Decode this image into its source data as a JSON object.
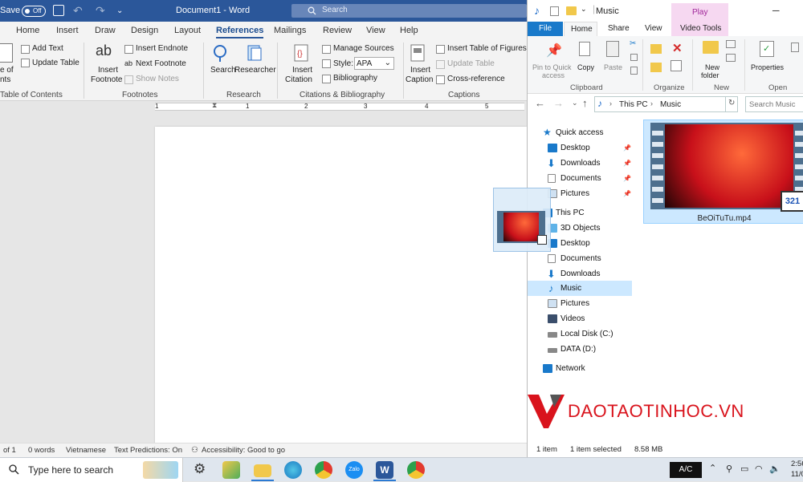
{
  "word": {
    "title": "Document1 - Word",
    "autosave_label": "Save",
    "autosave_state": "Off",
    "search_placeholder": "Search",
    "tabs": [
      "Home",
      "Insert",
      "Draw",
      "Design",
      "Layout",
      "References",
      "Mailings",
      "Review",
      "View",
      "Help"
    ],
    "active_tab": "References",
    "ribbon": {
      "toc_line1": "e of",
      "toc_line2": "nts",
      "add_text": "Add Text",
      "update_table": "Update Table",
      "toc_group": "Table of Contents",
      "insert_footnote_1": "Insert",
      "insert_footnote_2": "Footnote",
      "insert_endnote": "Insert Endnote",
      "next_footnote": "Next Footnote",
      "show_notes": "Show Notes",
      "footnotes_group": "Footnotes",
      "search": "Search",
      "researcher": "Researcher",
      "research_group": "Research",
      "insert_citation_1": "Insert",
      "insert_citation_2": "Citation",
      "manage_sources": "Manage Sources",
      "style_label": "Style:",
      "style_value": "APA",
      "bibliography": "Bibliography",
      "citations_group": "Citations & Bibliography",
      "insert_caption_1": "Insert",
      "insert_caption_2": "Caption",
      "insert_table_figures": "Insert Table of Figures",
      "update_table_2": "Update Table",
      "cross_reference": "Cross-reference",
      "captions_group": "Captions"
    },
    "ruler_numbers": [
      "1",
      "1",
      "2",
      "3",
      "4",
      "5"
    ],
    "status": {
      "page": "of 1",
      "words": "0 words",
      "language": "Vietnamese",
      "predictions": "Text Predictions: On",
      "accessibility": "Accessibility: Good to go"
    }
  },
  "explorer": {
    "title": "Music",
    "contextual_group": "Play",
    "tabs": [
      "File",
      "Home",
      "Share",
      "View",
      "Video Tools"
    ],
    "ribbon": {
      "pin_1": "Pin to Quick",
      "pin_2": "access",
      "copy": "Copy",
      "paste": "Paste",
      "clipboard_group": "Clipboard",
      "organize_group": "Organize",
      "new_folder_1": "New",
      "new_folder_2": "folder",
      "new_group": "New",
      "properties": "Properties",
      "open_group": "Open"
    },
    "breadcrumb": [
      "This PC",
      "Music"
    ],
    "search_placeholder": "Search Music",
    "nav": [
      {
        "label": "Quick access",
        "pinned": false,
        "icon": "star-icon"
      },
      {
        "label": "Desktop",
        "pinned": true,
        "icon": "desktop-icon"
      },
      {
        "label": "Downloads",
        "pinned": true,
        "icon": "download-icon"
      },
      {
        "label": "Documents",
        "pinned": true,
        "icon": "document-icon"
      },
      {
        "label": "Pictures",
        "pinned": true,
        "icon": "pictures-icon"
      },
      {
        "label": "This PC",
        "pinned": false,
        "icon": "pc-icon"
      },
      {
        "label": "3D Objects",
        "pinned": false,
        "icon": "cube-icon"
      },
      {
        "label": "Desktop",
        "pinned": false,
        "icon": "desktop-icon"
      },
      {
        "label": "Documents",
        "pinned": false,
        "icon": "document-icon"
      },
      {
        "label": "Downloads",
        "pinned": false,
        "icon": "download-icon"
      },
      {
        "label": "Music",
        "pinned": false,
        "icon": "music-icon",
        "selected": true
      },
      {
        "label": "Pictures",
        "pinned": false,
        "icon": "pictures-icon"
      },
      {
        "label": "Videos",
        "pinned": false,
        "icon": "video-icon"
      },
      {
        "label": "Local Disk (C:)",
        "pinned": false,
        "icon": "drive-icon"
      },
      {
        "label": "DATA (D:)",
        "pinned": false,
        "icon": "drive-icon"
      },
      {
        "label": "Network",
        "pinned": false,
        "icon": "network-icon"
      }
    ],
    "file": {
      "name": "BeOiTuTu.mp4",
      "badge": "321"
    },
    "status": {
      "count": "1 item",
      "selected": "1 item selected",
      "size": "8.58 MB"
    }
  },
  "watermark": {
    "text": "DAOTAOTINHOC.VN"
  },
  "taskbar": {
    "search_placeholder": "Type here to search",
    "ime": "A/C",
    "time": "2:56",
    "date": "11/0"
  },
  "colors": {
    "word_blue": "#2b579a",
    "explorer_file_tab": "#1979ca",
    "contextual": "#f6d8f1",
    "selected_item": "#cce8ff",
    "watermark_red": "#d9131c"
  }
}
